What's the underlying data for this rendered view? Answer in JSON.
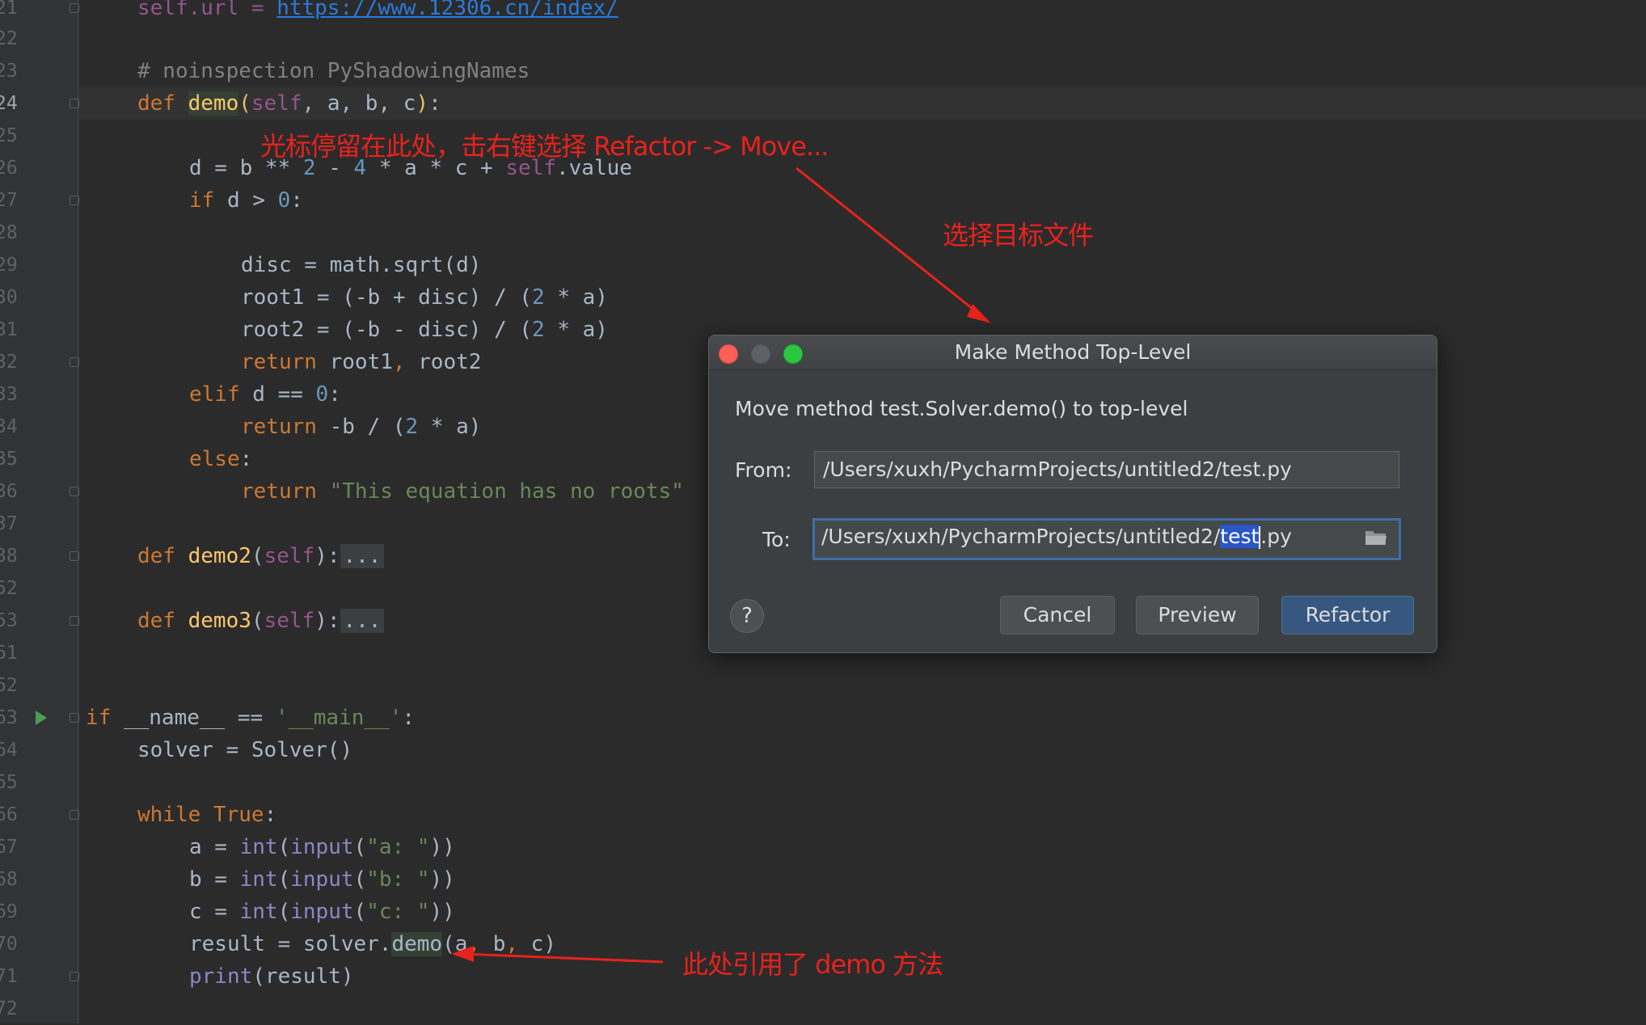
{
  "editor": {
    "line_numbers": [
      "21",
      "22",
      "23",
      "24",
      "25",
      "26",
      "27",
      "28",
      "29",
      "30",
      "31",
      "32",
      "33",
      "34",
      "35",
      "36",
      "37",
      "38",
      "52",
      "53",
      "61",
      "62",
      "63",
      "64",
      "65",
      "66",
      "67",
      "68",
      "69",
      "70",
      "71",
      "72"
    ],
    "code": {
      "l21": {
        "self_url": "self.url = ",
        "url": "https://www.12306.cn/index/"
      },
      "l23": "# noinspection PyShadowingNames",
      "l24": {
        "def": "def ",
        "name": "demo",
        "open": "(",
        "self": "self",
        "args": ", a, b, c",
        "close": ")",
        "colon": ":"
      },
      "l26": {
        "a": "d = b ** ",
        "n2": "2",
        "b": " - ",
        "n4": "4",
        "c": " * a * c + ",
        "self": "self",
        "d": ".value"
      },
      "l27": {
        "kw": "if",
        "a": " d > ",
        "n": "0",
        "b": ":"
      },
      "l29": "disc = math.sqrt(d)",
      "l30": {
        "a": "root1 = (-b + disc) / (",
        "n": "2",
        "b": " * a)"
      },
      "l31": {
        "a": "root2 = (-b - disc) / (",
        "n": "2",
        "b": " * a)"
      },
      "l32": {
        "kw": "return",
        "a": " root1",
        "comma": ",",
        "b": " root2"
      },
      "l33": {
        "kw": "elif",
        "a": " d == ",
        "n": "0",
        "b": ":"
      },
      "l34": {
        "kw": "return",
        "a": " -b / (",
        "n": "2",
        "b": " * a)"
      },
      "l35": {
        "kw": "else",
        "b": ":"
      },
      "l36": {
        "kw": "return",
        "str": " \"This equation has no roots\""
      },
      "l38": {
        "def": "def ",
        "name": "demo2",
        "open": "(",
        "self": "self",
        "close": "):",
        "dots": "..."
      },
      "l53": {
        "def": "def ",
        "name": "demo3",
        "open": "(",
        "self": "self",
        "close": "):",
        "dots": "..."
      },
      "l63": {
        "kw": "if",
        "a": " __name__ == ",
        "str": "'__main__'",
        "b": ":"
      },
      "l64": "solver = Solver()",
      "l66": {
        "kw": "while",
        "kw2": " True",
        "b": ":"
      },
      "l67": {
        "a": "a = ",
        "int": "int",
        "p": "(",
        "input": "input",
        "q": "(",
        "str": "\"a: \"",
        "r": "))"
      },
      "l68": {
        "a": "b = ",
        "int": "int",
        "p": "(",
        "input": "input",
        "q": "(",
        "str": "\"b: \"",
        "r": "))"
      },
      "l69": {
        "a": "c = ",
        "int": "int",
        "p": "(",
        "input": "input",
        "q": "(",
        "str": "\"c: \"",
        "r": "))"
      },
      "l70": {
        "a": "result = solver.",
        "m": "demo",
        "b": "(a",
        "c1": ",",
        "c": " b",
        "c2": ",",
        "d": " c)"
      },
      "l71": {
        "print": "print",
        "a": "(result)"
      }
    }
  },
  "annotations": {
    "cursor_note": "光标停留在此处，击右键选择 Refactor -> Move...",
    "target_note": "选择目标文件",
    "usage_note": "此处引用了 demo 方法"
  },
  "dialog": {
    "title": "Make Method Top-Level",
    "message": "Move method test.Solver.demo() to top-level",
    "from_label": "From:",
    "from_value": "/Users/xuxh/PycharmProjects/untitled2/test.py",
    "to_label": "To:",
    "to_prefix": "/Users/xuxh/PycharmProjects/untitled2/",
    "to_selected": "test",
    "to_suffix": ".py",
    "help_label": "?",
    "cancel_label": "Cancel",
    "preview_label": "Preview",
    "refactor_label": "Refactor"
  },
  "colors": {
    "editor_bg": "#2b2b2b",
    "gutter_bg": "#313335",
    "annotation_red": "#e8221c",
    "dialog_bg": "#3c3f41",
    "primary_button": "#365880",
    "selection": "#2a56c6"
  },
  "icons": [
    "run-gutter-icon",
    "fold-marker-icon",
    "close-traffic-light-icon",
    "minimize-traffic-light-icon",
    "zoom-traffic-light-icon",
    "folder-browse-icon",
    "help-icon",
    "annotation-arrow-icon"
  ]
}
